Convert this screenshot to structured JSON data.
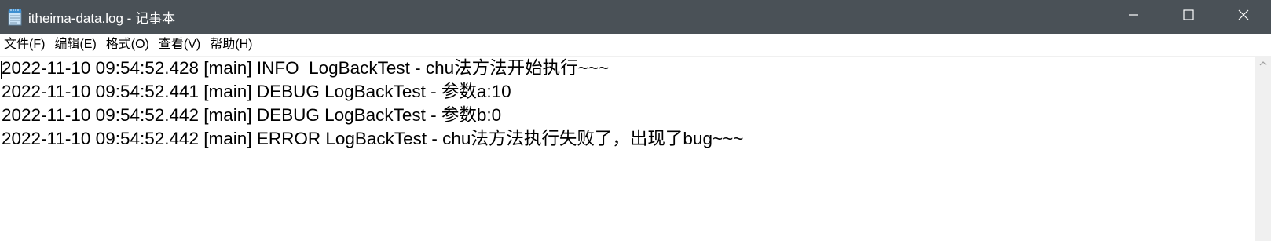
{
  "window": {
    "title": "itheima-data.log - 记事本",
    "icon": "notepad-icon",
    "colors": {
      "titlebar": "#4a5157",
      "titlebar_text": "#ffffff",
      "editor_bg": "#ffffff",
      "text": "#000000"
    }
  },
  "caption_buttons": {
    "minimize": "minimize-icon",
    "maximize": "maximize-icon",
    "close": "close-icon"
  },
  "menubar": {
    "items": [
      {
        "label": "文件(F)"
      },
      {
        "label": "编辑(E)"
      },
      {
        "label": "格式(O)"
      },
      {
        "label": "查看(V)"
      },
      {
        "label": "帮助(H)"
      }
    ]
  },
  "editor": {
    "lines": [
      {
        "text": "2022-11-10 09:54:52.428 [main] INFO  LogBackTest - chu法方法开始执行~~~"
      },
      {
        "text": "2022-11-10 09:54:52.441 [main] DEBUG LogBackTest - 参数a:10"
      },
      {
        "text": "2022-11-10 09:54:52.442 [main] DEBUG LogBackTest - 参数b:0"
      },
      {
        "text": "2022-11-10 09:54:52.442 [main] ERROR LogBackTest - chu法方法执行失败了，出现了bug~~~"
      }
    ]
  },
  "scrollbar": {
    "up_arrow": "chevron-up-icon"
  }
}
